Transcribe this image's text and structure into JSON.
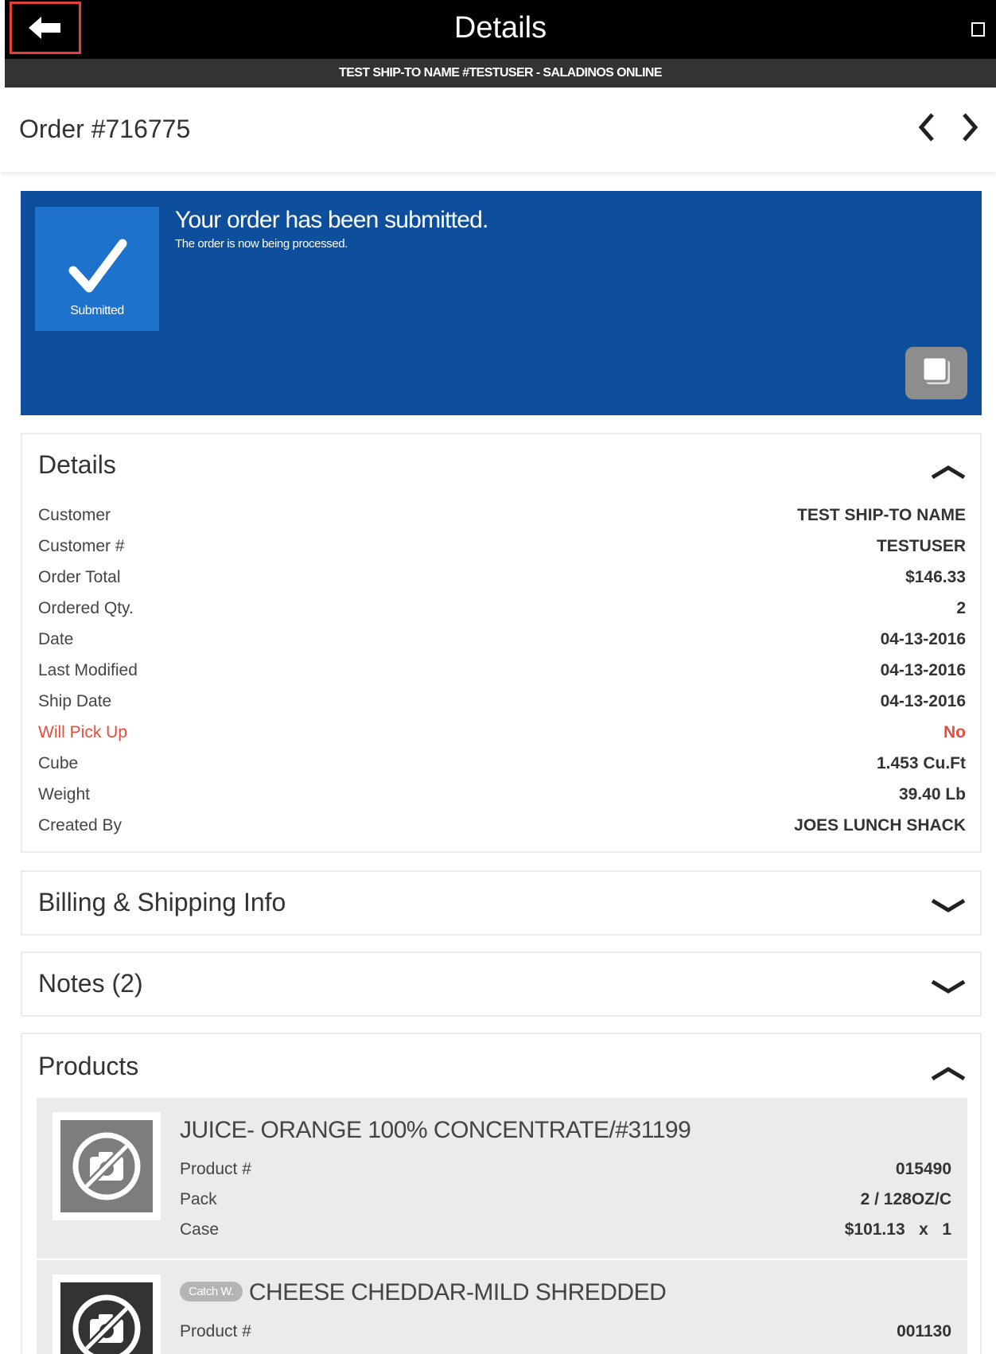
{
  "topbar": {
    "title": "Details",
    "back_icon": "arrow-left-icon",
    "window_icon": "window-square-icon"
  },
  "subheader": {
    "text": "TEST SHIP-TO NAME #TESTUSER - SALADINOS ONLINE"
  },
  "order": {
    "title": "Order #716775"
  },
  "banner": {
    "title": "Your order has been submitted.",
    "subtitle": "The order is now being processed.",
    "status_label": "Submitted",
    "background_color": "#0d4f9c",
    "status_box_color": "#1e72cc"
  },
  "details": {
    "title": "Details",
    "rows": [
      {
        "label": "Customer",
        "value": "TEST SHIP-TO NAME"
      },
      {
        "label": "Customer #",
        "value": "TESTUSER"
      },
      {
        "label": "Order Total",
        "value": "$146.33"
      },
      {
        "label": "Ordered Qty.",
        "value": "2"
      },
      {
        "label": "Date",
        "value": "04-13-2016"
      },
      {
        "label": "Last Modified",
        "value": "04-13-2016"
      },
      {
        "label": "Ship Date",
        "value": "04-13-2016"
      },
      {
        "label": "Will Pick Up",
        "value": "No"
      },
      {
        "label": "Cube",
        "value": "1.453 Cu.Ft"
      },
      {
        "label": "Weight",
        "value": "39.40 Lb"
      },
      {
        "label": "Created By",
        "value": "JOES LUNCH SHACK"
      }
    ],
    "alert_color": "#e74c3c"
  },
  "billing": {
    "title": "Billing & Shipping Info"
  },
  "notes": {
    "title": "Notes (2)"
  },
  "products": {
    "title": "Products",
    "items": [
      {
        "name": "JUICE- ORANGE 100% CONCENTRATE/#31199",
        "badge": "",
        "product_label": "Product #",
        "product_value": "015490",
        "pack_label": "Pack",
        "pack_value": "2 / 128OZ/C",
        "case_label": "Case",
        "case_value": "$101.13   x   1"
      },
      {
        "name": "CHEESE CHEDDAR-MILD SHREDDED",
        "badge": "Catch W.",
        "product_label": "Product #",
        "product_value": "001130"
      }
    ]
  }
}
